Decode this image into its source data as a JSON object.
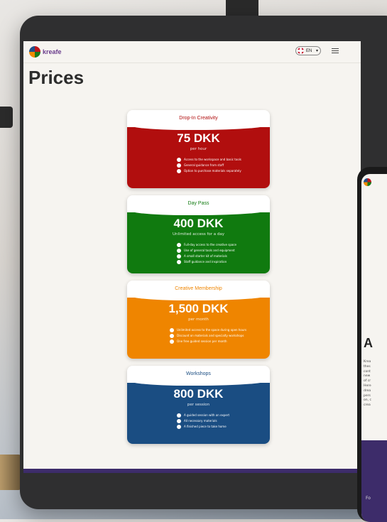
{
  "header": {
    "logo_text": "kreafe",
    "language": "EN"
  },
  "page_title": "Prices",
  "colors": {
    "red": "#b10e0e",
    "green": "#107a0f",
    "orange": "#ef8500",
    "blue": "#1a4d82",
    "footer": "#3d2c6a"
  },
  "cards": [
    {
      "name": "Drop-In Creativity",
      "price": "75 DKK",
      "period": "per hour",
      "features": [
        "Access to the workspace and basic tools",
        "General guidance from staff",
        "Option to purchase materials separately"
      ]
    },
    {
      "name": "Day Pass",
      "price": "400 DKK",
      "period": "Unlimited access for a day",
      "features": [
        "Full-day access to the creative space",
        "Use of general tools and equipment",
        "A small starter kit of materials",
        "Staff guidance and inspiration"
      ]
    },
    {
      "name": "Creative Membership",
      "price": "1,500 DKK",
      "period": "per month",
      "features": [
        "Unlimited access to the space during open hours",
        "Discount on materials and specialty workshops",
        "One free guided session per month"
      ]
    },
    {
      "name": "Workshops",
      "price": "800 DKK",
      "period": "per session",
      "features": [
        "A guided session with an expert",
        "All necessary materials",
        "A finished piece to take home"
      ]
    }
  ],
  "phone": {
    "heading": "A",
    "text": "Krea\nthes\ncont\nnew\nof cr\nHere\ndrea\npers\non, c\ncrea",
    "footer_text": "Fo"
  }
}
